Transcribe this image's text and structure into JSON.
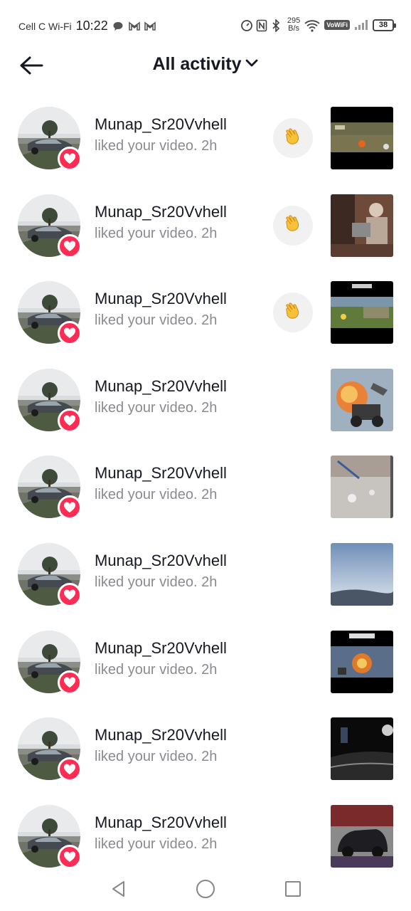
{
  "status_bar": {
    "carrier": "Cell C Wi-Fi",
    "time": "10:22",
    "net_speed_value": "295",
    "net_speed_unit": "B/s",
    "vowifi": "VoWiFi",
    "battery": "38"
  },
  "header": {
    "title": "All activity"
  },
  "activity": [
    {
      "username": "Munap_Sr20Vvhell",
      "action": "liked your video.",
      "time": "2h",
      "wave": true
    },
    {
      "username": "Munap_Sr20Vvhell",
      "action": "liked your video.",
      "time": "2h",
      "wave": true
    },
    {
      "username": "Munap_Sr20Vvhell",
      "action": "liked your video.",
      "time": "2h",
      "wave": true
    },
    {
      "username": "Munap_Sr20Vvhell",
      "action": "liked your video.",
      "time": "2h",
      "wave": false
    },
    {
      "username": "Munap_Sr20Vvhell",
      "action": "liked your video.",
      "time": "2h",
      "wave": false
    },
    {
      "username": "Munap_Sr20Vvhell",
      "action": "liked your video.",
      "time": "2h",
      "wave": false
    },
    {
      "username": "Munap_Sr20Vvhell",
      "action": "liked your video.",
      "time": "2h",
      "wave": false
    },
    {
      "username": "Munap_Sr20Vvhell",
      "action": "liked your video.",
      "time": "2h",
      "wave": false
    },
    {
      "username": "Munap_Sr20Vvhell",
      "action": "liked your video.",
      "time": "2h",
      "wave": false
    }
  ],
  "colors": {
    "heart_badge": "#fe2c55",
    "wave_bg": "#f1f1f2",
    "secondary_text": "#8a8b91",
    "primary_text": "#161823"
  },
  "icons": {
    "back": "arrow-left-icon",
    "title_dropdown": "chevron-down-icon",
    "badge": "heart-icon",
    "wave": "waving-hand-icon",
    "nav": [
      "back-triangle-icon",
      "home-circle-icon",
      "recents-square-icon"
    ]
  }
}
